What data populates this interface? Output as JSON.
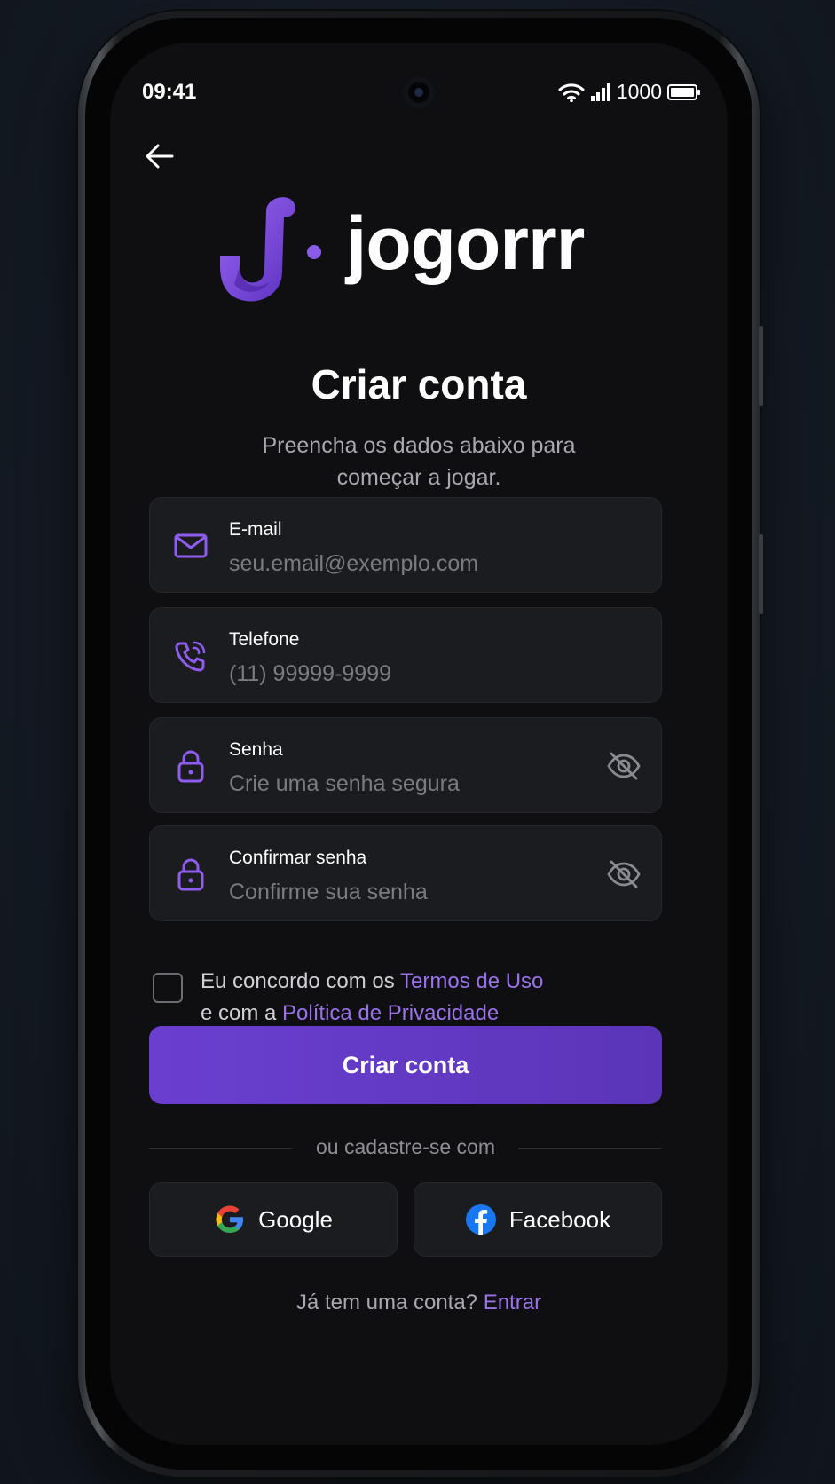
{
  "status_bar": {
    "time": "09:41",
    "battery": "1000"
  },
  "brand": {
    "name": "jogorrr",
    "accent": "#6a3fd0",
    "link": "#9b72ea"
  },
  "header": {
    "title": "Criar conta",
    "subtitle_line1": "Preencha os dados abaixo para",
    "subtitle_line2": "começar a jogar."
  },
  "form": {
    "email": {
      "label": "E-mail",
      "placeholder": "seu.email@exemplo.com",
      "value": "",
      "icon": "mail-icon"
    },
    "phone": {
      "label": "Telefone",
      "placeholder": "(11) 99999-9999",
      "value": "",
      "icon": "phone-icon"
    },
    "password": {
      "label": "Senha",
      "placeholder": "Crie uma senha segura",
      "value": "",
      "icon": "lock-icon"
    },
    "confirm": {
      "label": "Confirmar senha",
      "placeholder": "Confirme sua senha",
      "value": "",
      "icon": "lock-icon"
    }
  },
  "terms": {
    "prefix": "Eu concordo com os ",
    "terms_link": "Termos de Uso",
    "middle": "e com a ",
    "privacy_link": "Política de Privacidade",
    "checked": false
  },
  "actions": {
    "submit_label": "Criar conta",
    "divider_text": "ou cadastre-se com",
    "google_label": "Google",
    "facebook_label": "Facebook"
  },
  "footer": {
    "question": "Já tem uma conta? ",
    "login_link": "Entrar"
  }
}
